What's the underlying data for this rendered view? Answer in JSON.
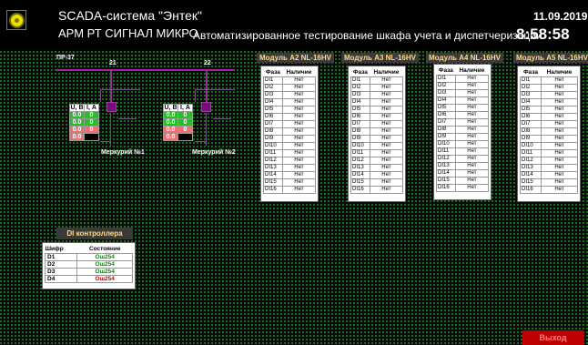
{
  "header": {
    "app_title": "SCADA-система \"Энтек\"",
    "app_subtitle": "АРМ РТ СИГНАЛ МИКРО",
    "page_title": "Автоматизированное тестирование шкафа учета и диспетчеризации",
    "date": "11.09.2019",
    "time": "8:58:58"
  },
  "colors": {
    "accent_status": "#f0e000",
    "bus": "#9a2a9a",
    "workspace_dots": "#1f7a1f",
    "exit": "#c00000"
  },
  "scheme": {
    "panel_label": "ПР-37",
    "bus_label_1": "21",
    "bus_label_2": "22",
    "meter_1": {
      "label": "Меркурий №1",
      "header_u": "U, В",
      "header_i": "I, А",
      "rows": [
        [
          "0.0",
          "0"
        ],
        [
          "0.0",
          "0"
        ],
        [
          "0.0",
          "0"
        ],
        [
          "0.0",
          ""
        ]
      ]
    },
    "meter_2": {
      "label": "Меркурий №2",
      "header_u": "U, В",
      "header_i": "I, А",
      "rows": [
        [
          "0.0",
          "0"
        ],
        [
          "0.0",
          "0"
        ],
        [
          "0.0",
          "0"
        ],
        [
          "0.0",
          ""
        ]
      ]
    }
  },
  "modules": [
    {
      "title": "Модуль А2 NL-16HV",
      "col1": "Фаза",
      "col2": "Наличие",
      "rows": [
        [
          "DI1",
          "Нет"
        ],
        [
          "DI2",
          "Нет"
        ],
        [
          "DI3",
          "Нет"
        ],
        [
          "DI4",
          "Нет"
        ],
        [
          "DI5",
          "Нет"
        ],
        [
          "DI6",
          "Нет"
        ],
        [
          "DI7",
          "Нет"
        ],
        [
          "DI8",
          "Нет"
        ],
        [
          "DI9",
          "Нет"
        ],
        [
          "DI10",
          "Нет"
        ],
        [
          "DI11",
          "Нет"
        ],
        [
          "DI12",
          "Нет"
        ],
        [
          "DI13",
          "Нет"
        ],
        [
          "DI14",
          "Нет"
        ],
        [
          "DI15",
          "Нет"
        ],
        [
          "DI16",
          "Нет"
        ]
      ]
    },
    {
      "title": "Модуль А3 NL-16HV",
      "col1": "Фаза",
      "col2": "Наличие",
      "rows": [
        [
          "DI1",
          "Нет"
        ],
        [
          "DI2",
          "Нет"
        ],
        [
          "DI3",
          "Нет"
        ],
        [
          "DI4",
          "Нет"
        ],
        [
          "DI5",
          "Нет"
        ],
        [
          "DI6",
          "Нет"
        ],
        [
          "DI7",
          "Нет"
        ],
        [
          "DI8",
          "Нет"
        ],
        [
          "DI9",
          "Нет"
        ],
        [
          "DI10",
          "Нет"
        ],
        [
          "DI11",
          "Нет"
        ],
        [
          "DI12",
          "Нет"
        ],
        [
          "DI13",
          "Нет"
        ],
        [
          "DI14",
          "Нет"
        ],
        [
          "DI15",
          "Нет"
        ],
        [
          "DI16",
          "Нет"
        ]
      ]
    },
    {
      "title": "Модуль А4 NL-16HV",
      "col1": "Фаза",
      "col2": "Наличие",
      "rows": [
        [
          "DI1",
          "Нет"
        ],
        [
          "DI2",
          "Нет"
        ],
        [
          "DI3",
          "Нет"
        ],
        [
          "DI4",
          "Нет"
        ],
        [
          "DI5",
          "Нет"
        ],
        [
          "DI6",
          "Нет"
        ],
        [
          "DI7",
          "Нет"
        ],
        [
          "DI8",
          "Нет"
        ],
        [
          "DI9",
          "Нет"
        ],
        [
          "DI10",
          "Нет"
        ],
        [
          "DI11",
          "Нет"
        ],
        [
          "DI12",
          "Нет"
        ],
        [
          "DI13",
          "Нет"
        ],
        [
          "DI14",
          "Нет"
        ],
        [
          "DI15",
          "Нет"
        ],
        [
          "DI16",
          "Нет"
        ]
      ]
    },
    {
      "title": "Модуль А5 NL-16HV",
      "col1": "Фаза",
      "col2": "Наличие",
      "rows": [
        [
          "DI1",
          "Нет"
        ],
        [
          "DI2",
          "Нет"
        ],
        [
          "DI3",
          "Нет"
        ],
        [
          "DI4",
          "Нет"
        ],
        [
          "DI5",
          "Нет"
        ],
        [
          "DI6",
          "Нет"
        ],
        [
          "DI7",
          "Нет"
        ],
        [
          "DI8",
          "Нет"
        ],
        [
          "DI9",
          "Нет"
        ],
        [
          "DI10",
          "Нет"
        ],
        [
          "DI11",
          "Нет"
        ],
        [
          "DI12",
          "Нет"
        ],
        [
          "DI13",
          "Нет"
        ],
        [
          "DI14",
          "Нет"
        ],
        [
          "DI15",
          "Нет"
        ],
        [
          "DI16",
          "Нет"
        ]
      ]
    }
  ],
  "di_controller": {
    "title": "DI контроллера",
    "col1": "Шифр",
    "col2": "Состояние",
    "rows": [
      {
        "code": "D1",
        "state": "Ош254",
        "color": "#0a8a0a"
      },
      {
        "code": "D2",
        "state": "Ош254",
        "color": "#0a8a0a"
      },
      {
        "code": "D3",
        "state": "Ош254",
        "color": "#0a8a0a"
      },
      {
        "code": "D4",
        "state": "Ош254",
        "color": "#cc0000"
      }
    ]
  },
  "footer": {
    "exit_label": "Выход"
  }
}
